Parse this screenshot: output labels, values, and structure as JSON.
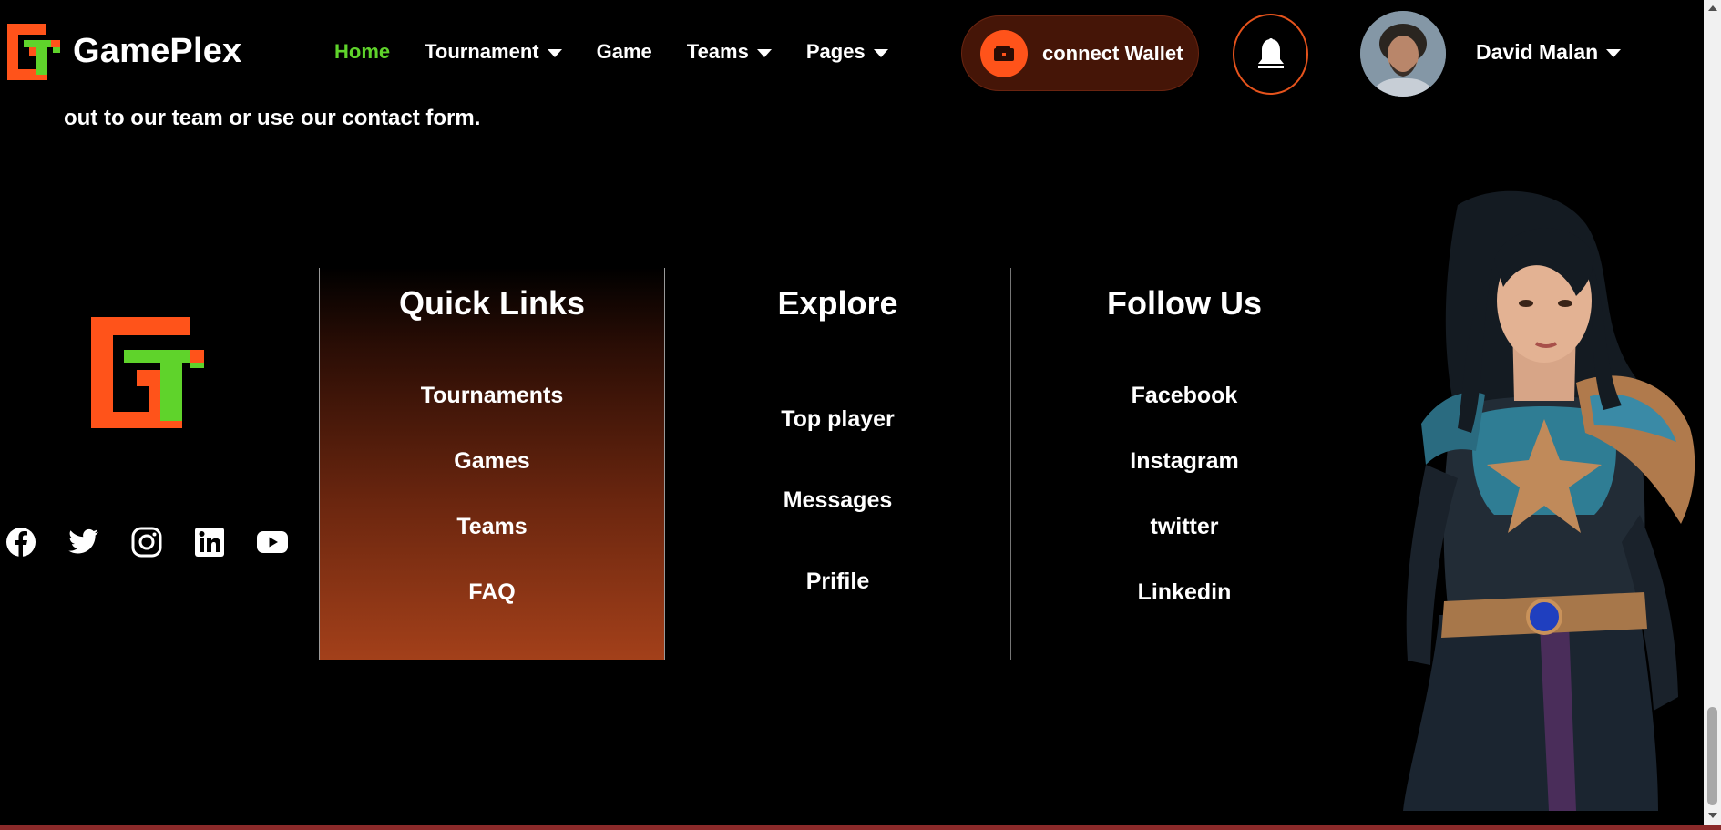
{
  "brand": {
    "name": "GamePlex",
    "logo_icon": "gameplex-logo-icon"
  },
  "nav": {
    "items": [
      {
        "label": "Home",
        "active": true,
        "dropdown": false
      },
      {
        "label": "Tournament",
        "active": false,
        "dropdown": true
      },
      {
        "label": "Game",
        "active": false,
        "dropdown": false
      },
      {
        "label": "Teams",
        "active": false,
        "dropdown": true
      },
      {
        "label": "Pages",
        "active": false,
        "dropdown": true
      }
    ]
  },
  "wallet": {
    "label": "connect Wallet",
    "icon": "wallet-icon"
  },
  "notifications": {
    "icon": "bell-icon"
  },
  "user": {
    "name": "David Malan",
    "avatar_icon": "avatar"
  },
  "intro": {
    "text": "out to our team or use our contact form."
  },
  "footer": {
    "socials": [
      "facebook-icon",
      "twitter-icon",
      "instagram-icon",
      "linkedin-icon",
      "youtube-icon"
    ],
    "quick_links": {
      "title": "Quick Links",
      "items": [
        "Tournaments",
        "Games",
        "Teams",
        "FAQ"
      ]
    },
    "explore": {
      "title": "Explore",
      "items": [
        "Top player",
        "Messages",
        "Prifile"
      ]
    },
    "follow_us": {
      "title": "Follow Us",
      "items": [
        "Facebook",
        "Instagram",
        "twitter",
        "Linkedin"
      ]
    }
  },
  "colors": {
    "accent_orange": "#ff531a",
    "accent_green": "#5fd32b",
    "background": "#000000",
    "wallet_bg": "#451507"
  }
}
